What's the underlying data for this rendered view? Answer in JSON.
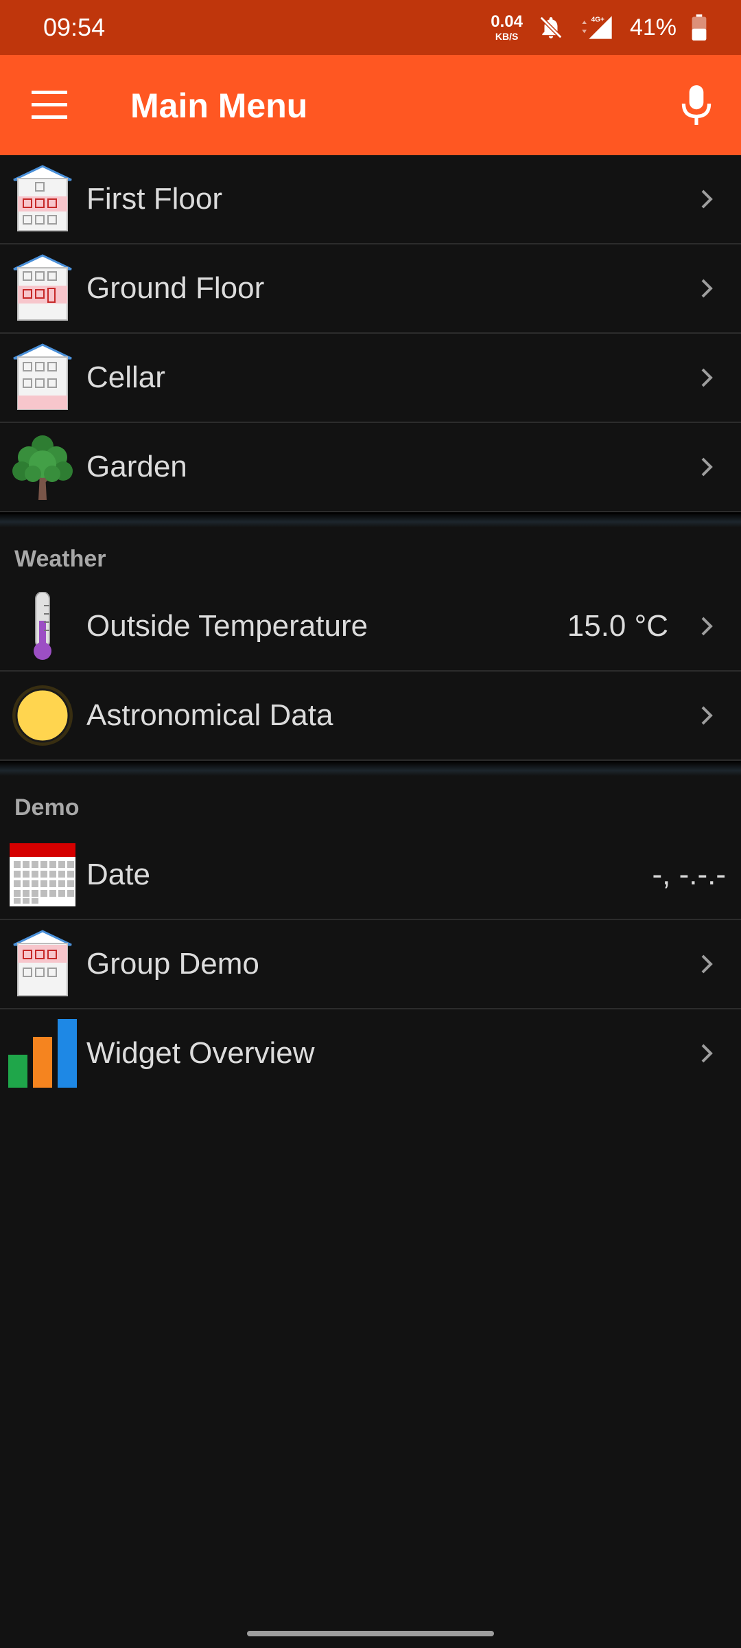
{
  "status_bar": {
    "time": "09:54",
    "net_speed": "0.04",
    "net_unit": "KB/S",
    "network_type": "4G+",
    "battery": "41%",
    "icons": [
      "bell-off-icon",
      "signal-icon",
      "battery-icon"
    ]
  },
  "app_bar": {
    "title": "Main Menu",
    "menu_icon": "hamburger-menu-icon",
    "mic_icon": "microphone-icon",
    "color": "#FF5722"
  },
  "sections": [
    {
      "header": "",
      "items": [
        {
          "label": "First Floor",
          "icon": "house-first-floor-icon",
          "value": ""
        },
        {
          "label": "Ground Floor",
          "icon": "house-ground-floor-icon",
          "value": ""
        },
        {
          "label": "Cellar",
          "icon": "house-cellar-icon",
          "value": ""
        },
        {
          "label": "Garden",
          "icon": "tree-icon",
          "value": ""
        }
      ]
    },
    {
      "header": "Weather",
      "items": [
        {
          "label": "Outside Temperature",
          "icon": "thermometer-icon",
          "value": "15.0 °C"
        },
        {
          "label": "Astronomical Data",
          "icon": "sun-icon",
          "value": ""
        }
      ]
    },
    {
      "header": "Demo",
      "items": [
        {
          "label": "Date",
          "icon": "calendar-icon",
          "value": "-, -.-.-"
        },
        {
          "label": "Group Demo",
          "icon": "house-group-icon",
          "value": ""
        },
        {
          "label": "Widget Overview",
          "icon": "bar-chart-icon",
          "value": ""
        }
      ]
    }
  ]
}
